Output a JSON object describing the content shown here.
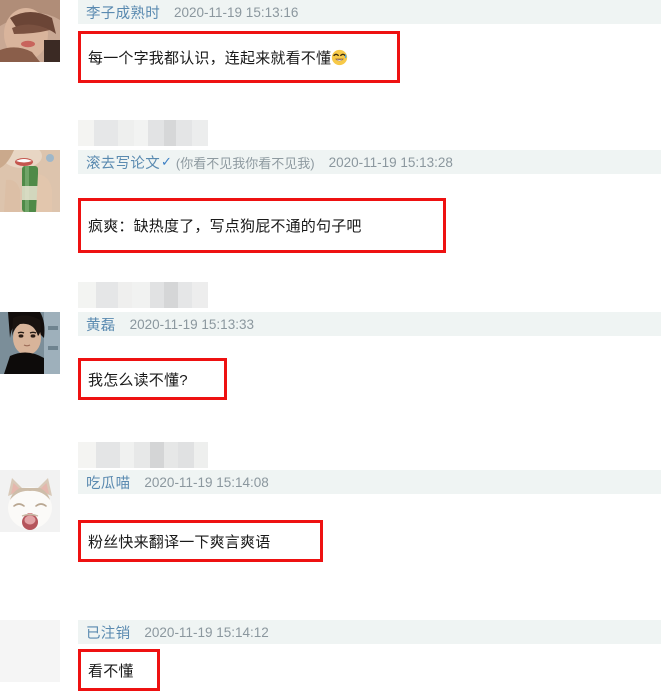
{
  "page": {
    "app": "weibo-comment-thread",
    "background": "#ffffff",
    "accent_red": "#ee1111",
    "username_color": "#5a8ab0",
    "timestamp_color": "#8b979e",
    "meta_band_color": "#eff4f3"
  },
  "comments": [
    {
      "username": "李子成熟时",
      "verified": "",
      "alias": "",
      "timestamp": "2020-11-19 15:13:16",
      "text": "每一个字我都认识，连起来就看不懂",
      "emoji": "sweat-grin-emoji",
      "avatar": "woman-face-photo",
      "redacted_above": false
    },
    {
      "username": "滚去写论文",
      "verified": "✓",
      "alias": "(你看不见我你看不见我)",
      "timestamp": "2020-11-19 15:13:28",
      "text": "疯爽：缺热度了，写点狗屁不通的句子吧",
      "emoji": "",
      "avatar": "woman-with-bottle-photo",
      "redacted_above": true
    },
    {
      "username": "黄磊",
      "verified": "",
      "alias": "",
      "timestamp": "2020-11-19 15:13:33",
      "text": "我怎么读不懂?",
      "emoji": "",
      "avatar": "man-dark-hair-photo",
      "redacted_above": true
    },
    {
      "username": "吃瓜喵",
      "verified": "",
      "alias": "",
      "timestamp": "2020-11-19 15:14:08",
      "text": "粉丝快来翻译一下爽言爽语",
      "emoji": "",
      "avatar": "white-cat-photo",
      "redacted_above": true
    },
    {
      "username": "已注销",
      "verified": "",
      "alias": "",
      "timestamp": "2020-11-19 15:14:12",
      "text": "看不懂",
      "emoji": "",
      "avatar": "blank-deleted-avatar",
      "redacted_above": false
    }
  ]
}
